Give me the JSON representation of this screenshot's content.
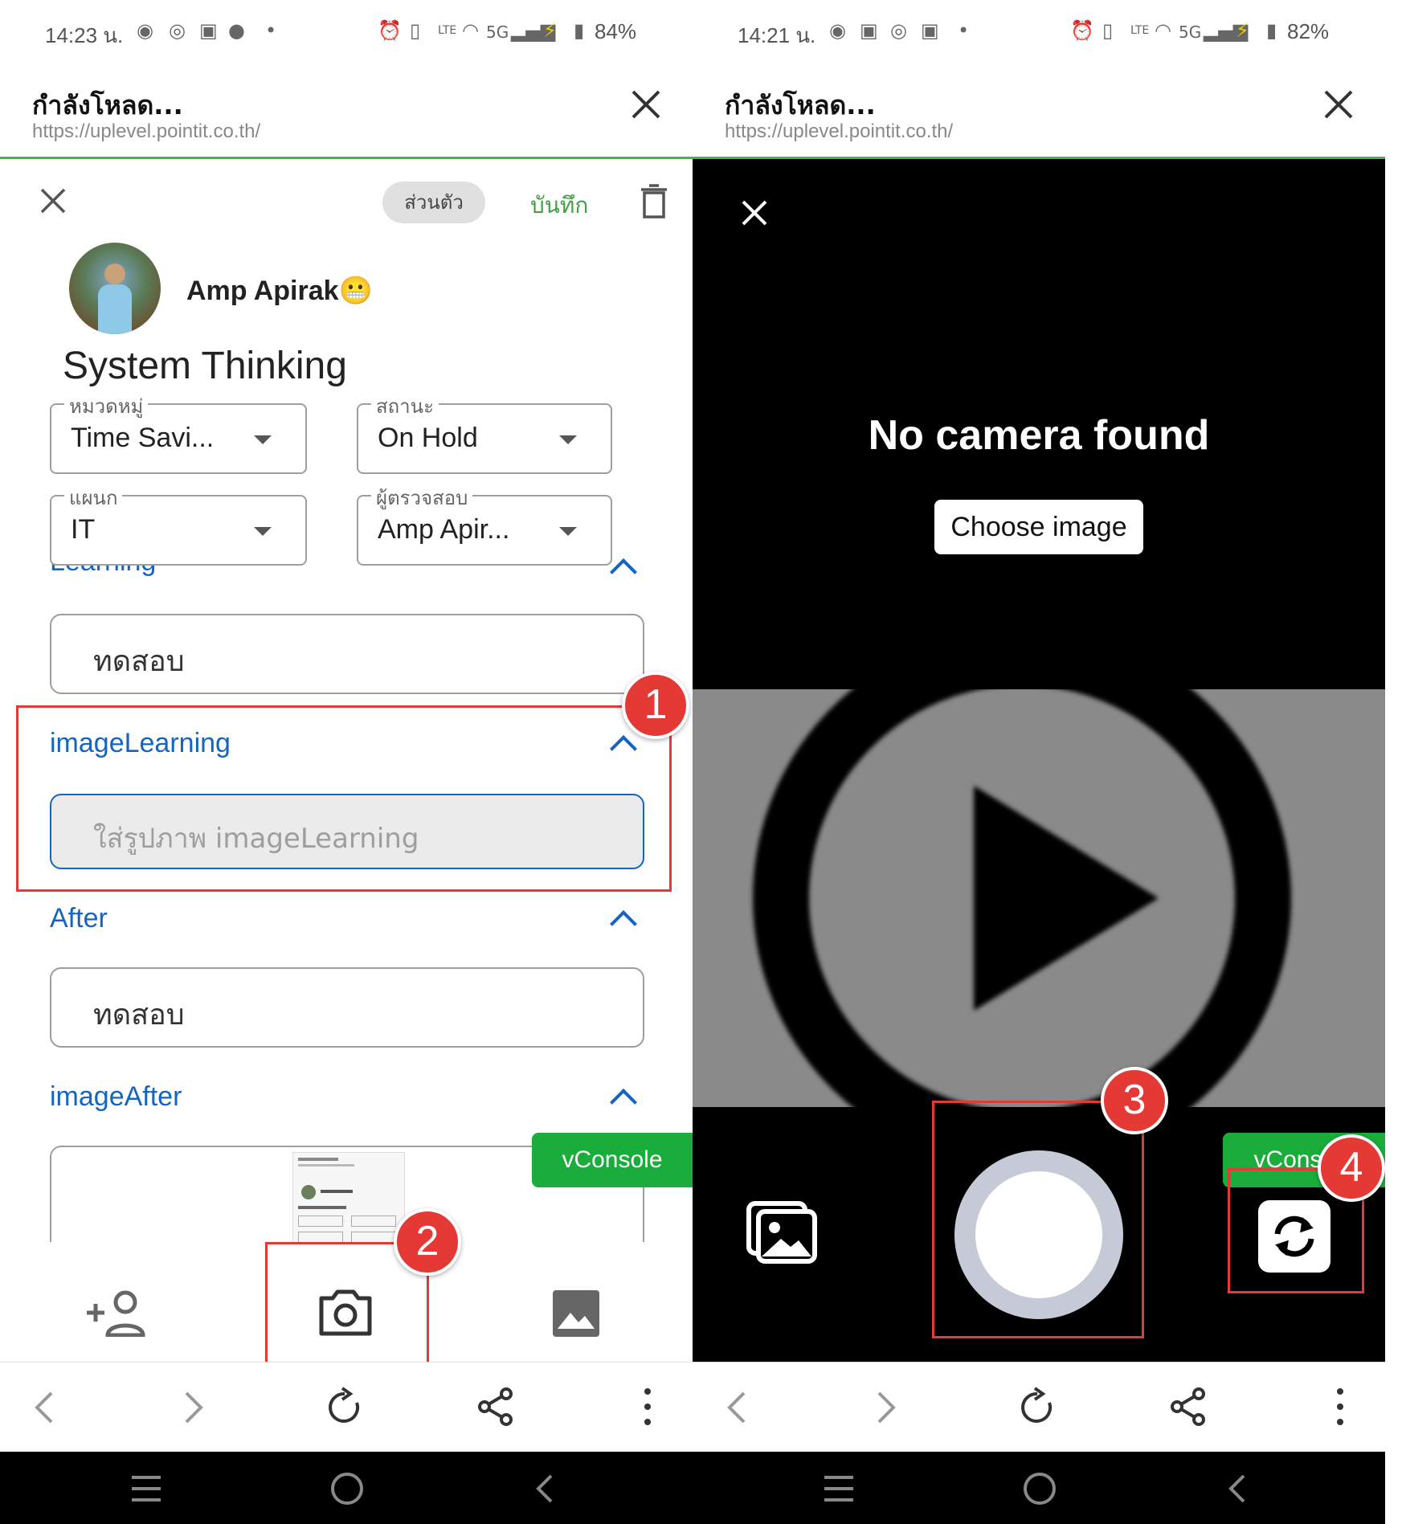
{
  "left": {
    "status": {
      "time": "14:23 น.",
      "battery": "84%"
    },
    "url_bar": {
      "title": "กำลังโหลด...",
      "url": "https://uplevel.pointit.co.th/"
    },
    "toolbar": {
      "visibility_chip": "ส่วนตัว",
      "save_label": "บันทึก"
    },
    "user": {
      "name": "Amp Apirak",
      "emoji": "😬"
    },
    "page_title": "System Thinking",
    "fields": {
      "category": {
        "label": "หมวดหมู่",
        "value": "Time Savi..."
      },
      "status": {
        "label": "สถานะ",
        "value": "On Hold"
      },
      "department": {
        "label": "แผนก",
        "value": "IT"
      },
      "reviewer": {
        "label": "ผู้ตรวจสอบ",
        "value": "Amp Apir..."
      }
    },
    "sections": {
      "learning": {
        "title": "Learning",
        "value": "ทดสอบ"
      },
      "image_learning": {
        "title": "imageLearning",
        "placeholder": "ใส่รูปภาพ imageLearning"
      },
      "after": {
        "title": "After",
        "value": "ทดสอบ"
      },
      "image_after": {
        "title": "imageAfter"
      }
    },
    "vconsole": "vConsole",
    "badges": {
      "b1": "1",
      "b2": "2"
    },
    "bottom_tools": [
      "add-person-icon",
      "camera-icon",
      "image-icon"
    ]
  },
  "right": {
    "status": {
      "time": "14:21 น.",
      "battery": "82%"
    },
    "url_bar": {
      "title": "กำลังโหลด...",
      "url": "https://uplevel.pointit.co.th/"
    },
    "camera": {
      "message": "No camera found",
      "choose_image": "Choose image"
    },
    "vconsole": "vConsole",
    "badges": {
      "b3": "3",
      "b4": "4"
    }
  },
  "colors": {
    "accent_green": "#4caf50",
    "link_blue": "#1565c0",
    "annotation_red": "#e53935",
    "vconsole_green": "#1aad3b"
  }
}
